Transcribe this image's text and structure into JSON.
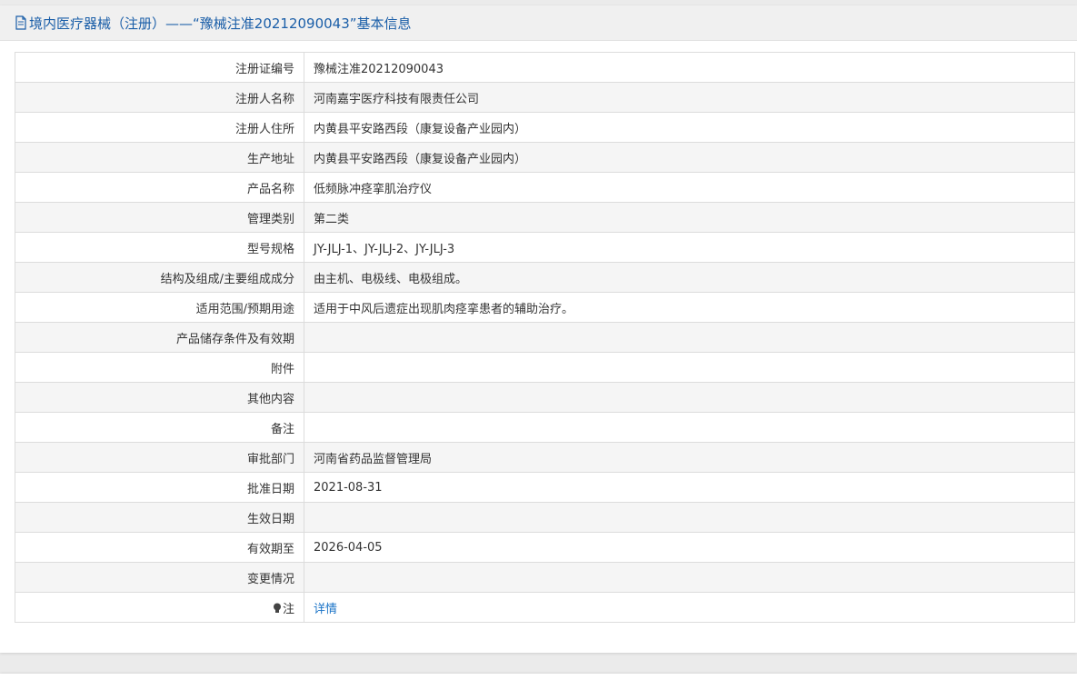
{
  "header": {
    "title": "境内医疗器械（注册）——“豫械注准20212090043”基本信息",
    "icon": "document-icon"
  },
  "rows": [
    {
      "label": "注册证编号",
      "value": "豫械注准20212090043"
    },
    {
      "label": "注册人名称",
      "value": "河南嘉宇医疗科技有限责任公司"
    },
    {
      "label": "注册人住所",
      "value": "内黄县平安路西段（康复设备产业园内）"
    },
    {
      "label": "生产地址",
      "value": "内黄县平安路西段（康复设备产业园内）"
    },
    {
      "label": "产品名称",
      "value": "低频脉冲痉挛肌治疗仪"
    },
    {
      "label": "管理类别",
      "value": "第二类"
    },
    {
      "label": "型号规格",
      "value": "JY-JLJ-1、JY-JLJ-2、JY-JLJ-3"
    },
    {
      "label": "结构及组成/主要组成成分",
      "value": "由主机、电极线、电极组成。"
    },
    {
      "label": "适用范围/预期用途",
      "value": "适用于中风后遗症出现肌肉痉挛患者的辅助治疗。"
    },
    {
      "label": "产品储存条件及有效期",
      "value": ""
    },
    {
      "label": "附件",
      "value": ""
    },
    {
      "label": "其他内容",
      "value": ""
    },
    {
      "label": "备注",
      "value": ""
    },
    {
      "label": "审批部门",
      "value": "河南省药品监督管理局"
    },
    {
      "label": "批准日期",
      "value": "2021-08-31"
    },
    {
      "label": "生效日期",
      "value": ""
    },
    {
      "label": "有效期至",
      "value": "2026-04-05"
    },
    {
      "label": "变更情况",
      "value": ""
    }
  ],
  "note": {
    "label": "注",
    "icon": "lightbulb-icon",
    "link_text": "详情"
  }
}
